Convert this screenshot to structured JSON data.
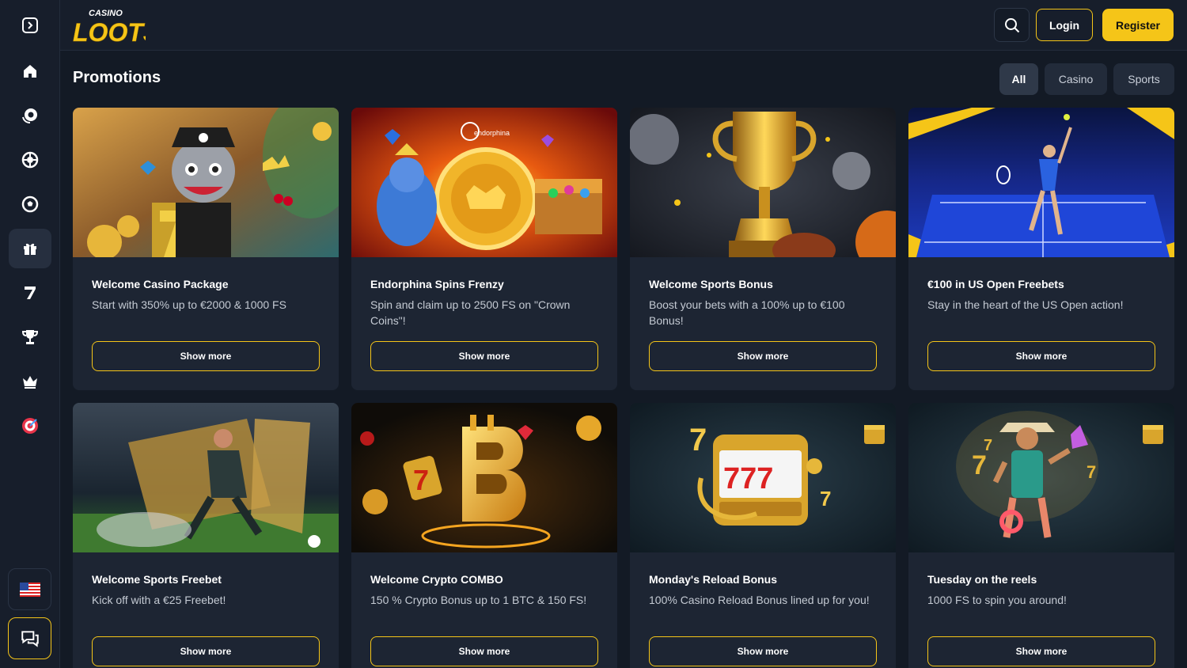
{
  "header": {
    "logo_top": "CASINO",
    "logo_main": "LOOTS",
    "login_label": "Login",
    "register_label": "Register"
  },
  "sidebar": {
    "items": [
      {
        "icon": "collapse-icon"
      },
      {
        "icon": "home-icon"
      },
      {
        "icon": "casino-chip-icon"
      },
      {
        "icon": "roulette-icon"
      },
      {
        "icon": "soccer-ball-icon"
      },
      {
        "icon": "gift-icon",
        "active": true
      },
      {
        "icon": "seven-icon"
      },
      {
        "icon": "trophy-icon"
      },
      {
        "icon": "crown-icon"
      },
      {
        "icon": "target-icon"
      }
    ],
    "flag_icon": "us-flag-icon",
    "chat_icon": "chat-icon"
  },
  "page": {
    "title": "Promotions",
    "filters": [
      "All",
      "Casino",
      "Sports"
    ],
    "active_filter": "All"
  },
  "promotions": [
    {
      "title": "Welcome Casino Package",
      "description": "Start with 350% up to €2000 & 1000 FS",
      "button": "Show more",
      "image": "pirate-raccoon"
    },
    {
      "title": "Endorphina Spins Frenzy",
      "description": "Spin and claim up to 2500 FS on \"Crown Coins\"!",
      "button": "Show more",
      "image": "ganesha-coin",
      "image_brand": "endorphina"
    },
    {
      "title": "Welcome Sports Bonus",
      "description": "Boost your bets with a 100% up to €100 Bonus!",
      "button": "Show more",
      "image": "gold-trophy"
    },
    {
      "title": "€100 in US Open Freebets",
      "description": "Stay in the heart of the US Open action!",
      "button": "Show more",
      "image": "tennis-player"
    },
    {
      "title": "Welcome Sports Freebet",
      "description": "Kick off with a €25 Freebet!",
      "button": "Show more",
      "image": "soccer-player"
    },
    {
      "title": "Welcome Crypto COMBO",
      "description": "150 % Crypto Bonus up to 1 BTC & 150 FS!",
      "button": "Show more",
      "image": "bitcoin"
    },
    {
      "title": "Monday's Reload Bonus",
      "description": "100% Casino Reload Bonus lined up for you!",
      "button": "Show more",
      "image": "slot-machine-777"
    },
    {
      "title": "Tuesday on the reels",
      "description": "1000 FS to spin you around!",
      "button": "Show more",
      "image": "cowboy-character"
    }
  ],
  "colors": {
    "accent": "#f5c518",
    "background": "#131a25",
    "card": "#1d2533"
  }
}
